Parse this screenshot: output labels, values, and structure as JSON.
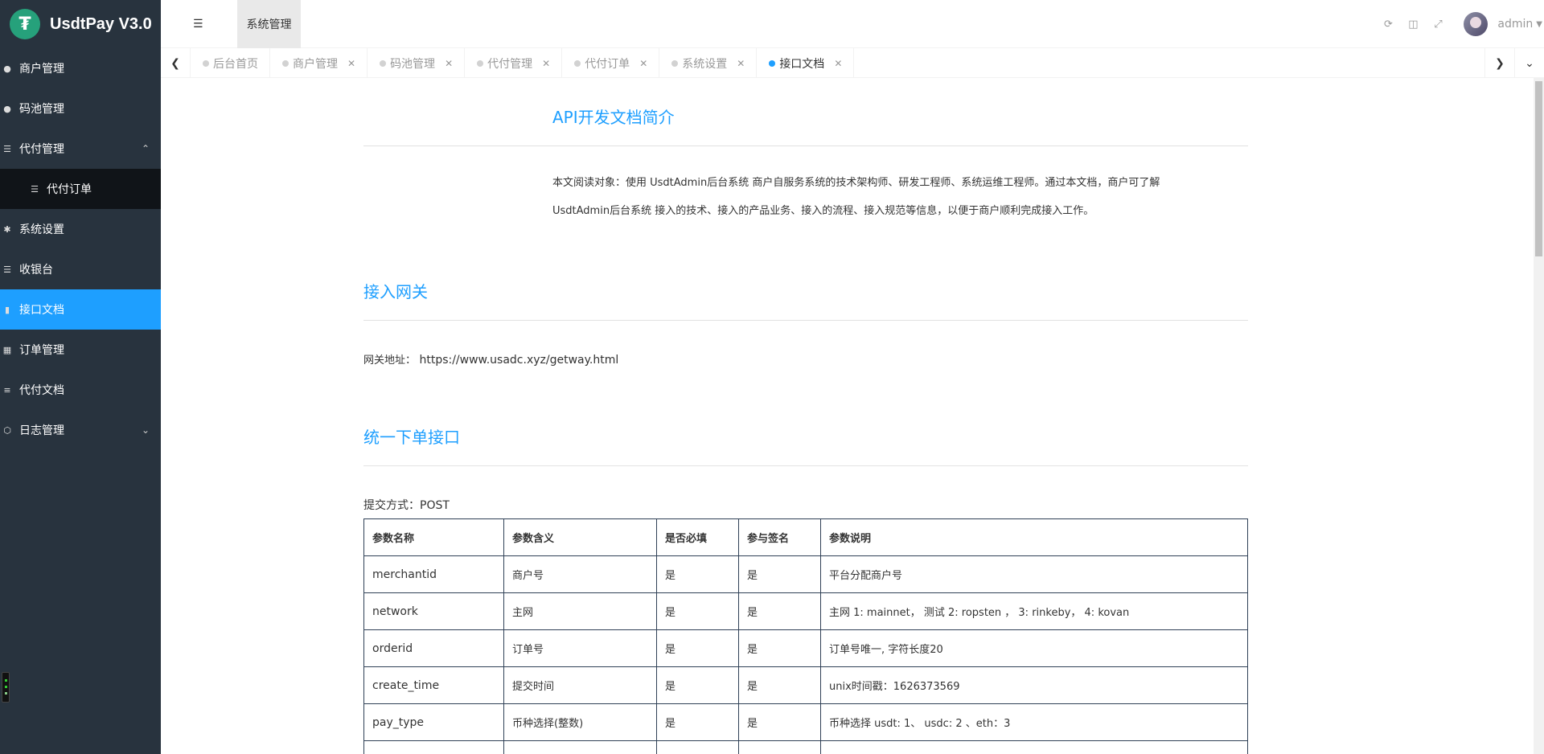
{
  "brand": {
    "name": "UsdtPay V3.0",
    "logo_glyph": "₮",
    "color": "#26a17b"
  },
  "sidebar": {
    "items": [
      {
        "label": "商户管理",
        "icon": "user-icon"
      },
      {
        "label": "码池管理",
        "icon": "android-icon"
      },
      {
        "label": "代付管理",
        "icon": "list-icon",
        "expanded": true
      },
      {
        "label": "代付订单",
        "icon": "list-icon",
        "sub": true
      },
      {
        "label": "系统设置",
        "icon": "gear-icon"
      },
      {
        "label": "收银台",
        "icon": "list-icon"
      },
      {
        "label": "接口文档",
        "icon": "book-icon",
        "active": true
      },
      {
        "label": "订单管理",
        "icon": "calculator-icon"
      },
      {
        "label": "代付文档",
        "icon": "align-icon"
      },
      {
        "label": "日志管理",
        "icon": "cube-icon",
        "collapsed": true
      }
    ],
    "active_color": "#1e9fff",
    "bg_color": "#28333e"
  },
  "header": {
    "module_tab": "系统管理",
    "user": "admin",
    "icons": [
      "refresh-icon",
      "trash-icon",
      "fullscreen-icon"
    ]
  },
  "tabs": [
    {
      "label": "后台首页",
      "closable": false
    },
    {
      "label": "商户管理",
      "closable": true
    },
    {
      "label": "码池管理",
      "closable": true
    },
    {
      "label": "代付管理",
      "closable": true
    },
    {
      "label": "代付订单",
      "closable": true
    },
    {
      "label": "系统设置",
      "closable": true
    },
    {
      "label": "接口文档",
      "closable": true,
      "active": true
    }
  ],
  "doc": {
    "intro_title": "API开发文档简介",
    "intro_line1": "本文阅读对象：使用 UsdtAdmin后台系统 商户自服务系统的技术架构师、研发工程师、系统运维工程师。通过本文档，商户可了解",
    "intro_line2": "UsdtAdmin后台系统 接入的技术、接入的产品业务、接入的流程、接入规范等信息，以便于商户顺利完成接入工作。",
    "gateway_title": "接入网关",
    "gateway_label": "网关地址：",
    "gateway_url": "https://www.usadc.xyz/getway.html",
    "order_title": "统一下单接口",
    "method": "提交方式：POST",
    "table": {
      "headers": [
        "参数名称",
        "参数含义",
        "是否必填",
        "参与签名",
        "参数说明"
      ],
      "rows": [
        [
          "merchantid",
          "商户号",
          "是",
          "是",
          "平台分配商户号"
        ],
        [
          "network",
          "主网",
          "是",
          "是",
          "主网 1: mainnet， 测试 2: ropsten ， 3: rinkeby， 4: kovan"
        ],
        [
          "orderid",
          "订单号",
          "是",
          "是",
          "订单号唯一, 字符长度20"
        ],
        [
          "create_time",
          "提交时间",
          "是",
          "是",
          "unix时间戳：1626373569"
        ],
        [
          "pay_type",
          "币种选择(整数)",
          "是",
          "是",
          "币种选择 usdt: 1、 usdc: 2 、eth：3"
        ],
        [
          "",
          "",
          "",
          "",
          ""
        ]
      ]
    }
  }
}
